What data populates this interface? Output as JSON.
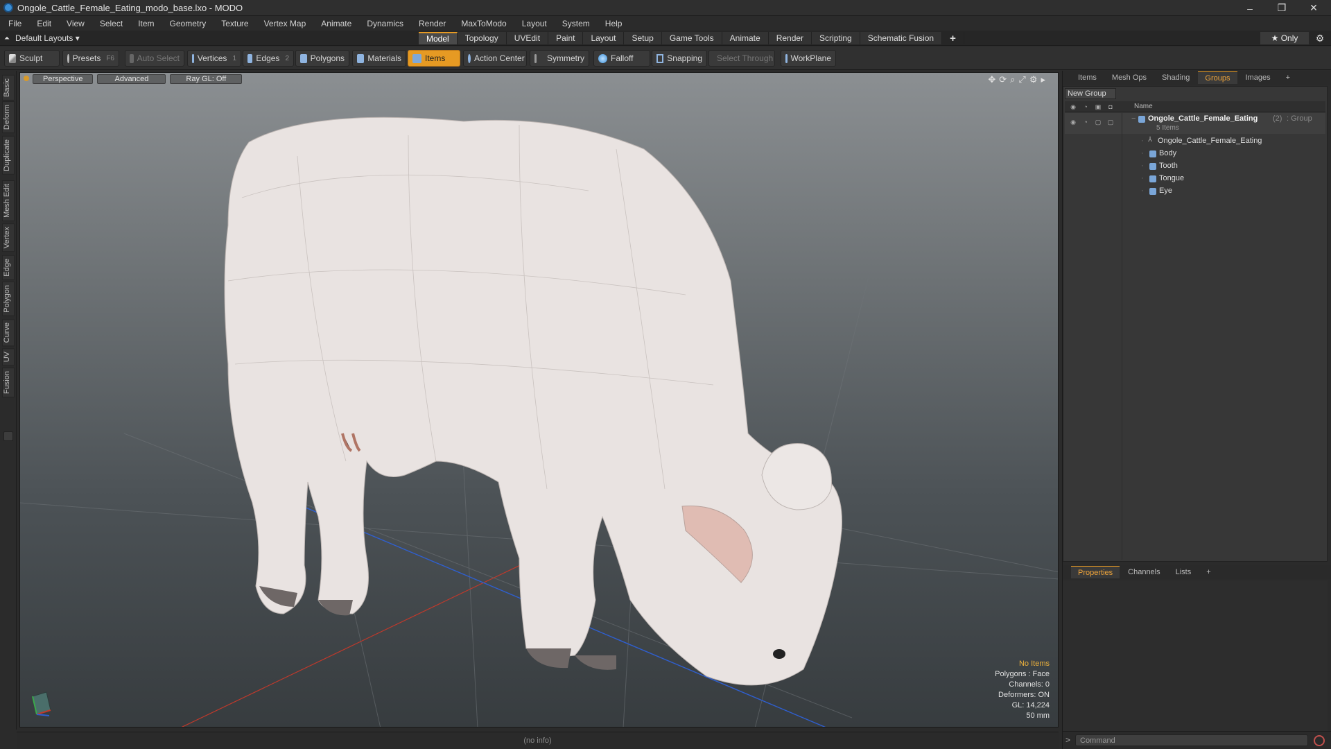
{
  "window": {
    "title": "Ongole_Cattle_Female_Eating_modo_base.lxo - MODO",
    "minimize": "–",
    "restore": "❐",
    "close": "✕"
  },
  "menu": [
    "File",
    "Edit",
    "View",
    "Select",
    "Item",
    "Geometry",
    "Texture",
    "Vertex Map",
    "Animate",
    "Dynamics",
    "Render",
    "MaxToModo",
    "Layout",
    "System",
    "Help"
  ],
  "layoutbar": {
    "layouts_label": "Default Layouts ▾",
    "tabs": [
      "Model",
      "Topology",
      "UVEdit",
      "Paint",
      "Layout",
      "Setup",
      "Game Tools",
      "Animate",
      "Render",
      "Scripting",
      "Schematic Fusion"
    ],
    "active_tab": "Model",
    "add_tab": "+",
    "only_label": "★ Only"
  },
  "toolbar": {
    "sculpt": "Sculpt",
    "presets": "Presets",
    "presets_hotkey": "F6",
    "auto_select": "Auto Select",
    "vertices": "Vertices",
    "vertices_count": "1",
    "edges": "Edges",
    "edges_count": "2",
    "polygons": "Polygons",
    "materials": "Materials",
    "items": "Items",
    "action_center": "Action Center",
    "symmetry": "Symmetry",
    "falloff": "Falloff",
    "snapping": "Snapping",
    "select_through": "Select Through",
    "workplane": "WorkPlane"
  },
  "left_tabs": [
    "Basic",
    "Deform",
    "Duplicate",
    "Mesh Edit",
    "Vertex",
    "Edge",
    "Polygon",
    "Curve",
    "UV",
    "Fusion"
  ],
  "viewport": {
    "view_mode": "Perspective",
    "shading": "Advanced",
    "raygl": "Ray GL: Off",
    "stats": {
      "selection": "No Items",
      "polygons": "Polygons : Face",
      "channels": "Channels: 0",
      "deformers": "Deformers: ON",
      "gl": "GL: 14,224",
      "lens": "50 mm"
    }
  },
  "status_bar": "(no info)",
  "right_panel": {
    "top_tabs": [
      "Items",
      "Mesh Ops",
      "Shading",
      "Groups",
      "Images"
    ],
    "active_top_tab": "Groups",
    "add_tab": "+",
    "new_group_label": "New Group",
    "name_header": "Name",
    "group": {
      "name": "Ongole_Cattle_Female_Eating",
      "count": "(2)",
      "type": ": Group",
      "items_label": "5 Items"
    },
    "children": [
      "Ongole_Cattle_Female_Eating",
      "Body",
      "Tooth",
      "Tongue",
      "Eye"
    ],
    "bottom_tabs": [
      "Properties",
      "Channels",
      "Lists"
    ],
    "active_bottom_tab": "Properties",
    "command_placeholder": "Command",
    "command_prompt": ">"
  },
  "colors": {
    "accent": "#e69a23",
    "viewport_top": "#8b8f92",
    "viewport_bottom": "#373c3f",
    "axis_x": "#c0392b",
    "axis_z": "#2f5fd0"
  }
}
